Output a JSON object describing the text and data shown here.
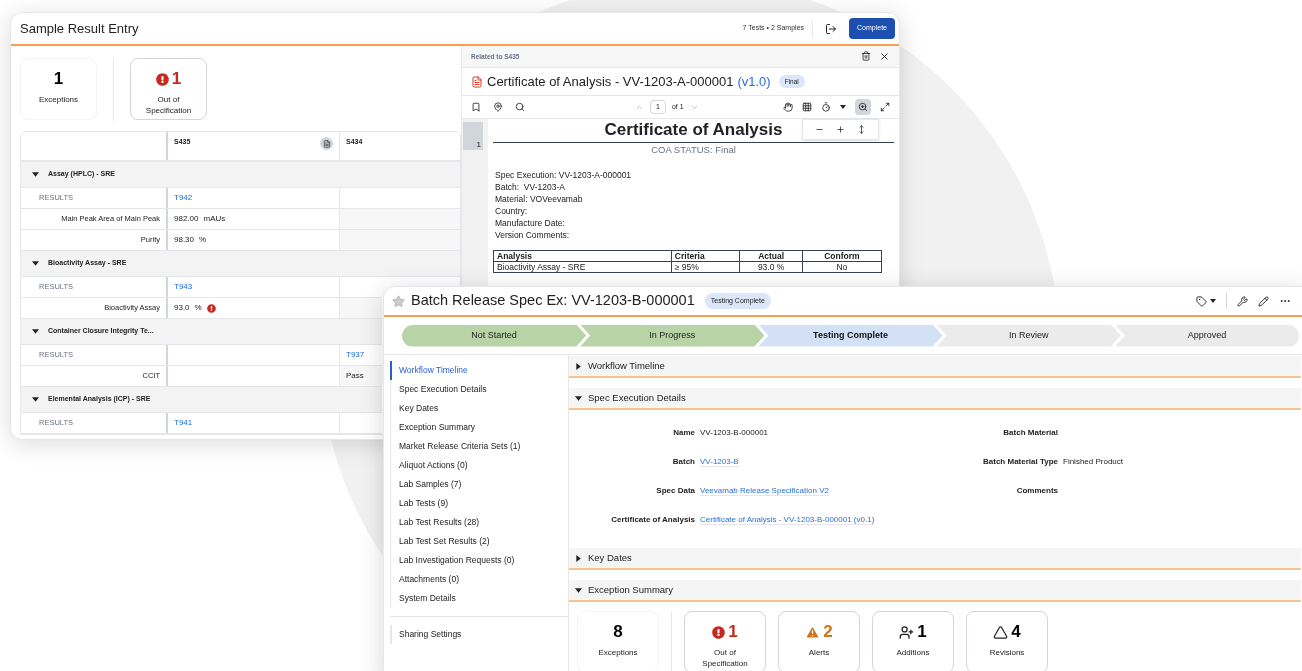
{
  "result_entry": {
    "title": "Sample Result Entry",
    "summary": "7 Tests • 2 Samples",
    "complete_button": "Complete",
    "stats": [
      {
        "kind": "plain",
        "value": "1",
        "label": "Exceptions"
      },
      {
        "kind": "oos",
        "value": "1",
        "label": "Out of Specification"
      }
    ],
    "columns": [
      "S435",
      "S434"
    ],
    "groups": [
      {
        "name": "Assay (HPLC) - SRE",
        "expanded": true,
        "rows": [
          {
            "kind": "results",
            "label": "RESULTS",
            "cell_1": {
              "text": "T942"
            }
          },
          {
            "kind": "value",
            "label": "Main Peak Area of Main Peak",
            "cell_1": {
              "text": "982.00",
              "unit": "mAUs",
              "oos": false
            }
          },
          {
            "kind": "value",
            "label": "Purity",
            "cell_1": {
              "text": "98.30",
              "unit": "%",
              "oos": false
            }
          }
        ]
      },
      {
        "name": "Bioactivity Assay - SRE",
        "expanded": true,
        "rows": [
          {
            "kind": "results",
            "label": "RESULTS",
            "cell_1": {
              "text": "T943"
            }
          },
          {
            "kind": "value",
            "label": "Bioactivity Assay",
            "cell_1": {
              "text": "93.0",
              "unit": "%",
              "oos": true
            }
          }
        ]
      },
      {
        "name": "Container Closure Integrity Te...",
        "expanded": true,
        "rows": [
          {
            "kind": "results",
            "label": "RESULTS",
            "cell_2": {
              "text": "T937"
            }
          },
          {
            "kind": "value",
            "label": "CCIT",
            "cell_2": {
              "text": "Pass"
            }
          }
        ]
      },
      {
        "name": "Elemental Analysis (ICP) - SRE",
        "expanded": true,
        "rows": [
          {
            "kind": "results",
            "label": "RESULTS",
            "cell_1": {
              "text": "T941"
            }
          }
        ]
      }
    ],
    "viewer": {
      "related": "Related to S435",
      "doc_title": "Certificate of Analysis - VV-1203-A-000001",
      "version": "(v1.0)",
      "badge": "Final",
      "page": "1",
      "page_total": "of 1",
      "thumbnail_page": "1",
      "document": {
        "title": "Certificate of Analysis",
        "status": "COA STATUS: Final",
        "lines": [
          "Spec Execution: VV-1203-A-000001",
          "Batch:  VV-1203-A",
          "Material: VOVeevamab",
          "Country:",
          "Manufacture Date:",
          "Version Comments:"
        ],
        "table_columns": [
          "Analysis",
          "Criteria",
          "Actual",
          "Conform"
        ],
        "table_rows": [
          [
            "Bioactivity Assay - SRE",
            "≥ 95%",
            "93.0 %",
            "No"
          ]
        ]
      }
    }
  },
  "batch_release": {
    "title": "Batch Release Spec Ex: VV-1203-B-000001",
    "favorite": false,
    "badge": "Testing Complete",
    "stages": [
      {
        "label": "Not Started",
        "kind": "done"
      },
      {
        "label": "In Progress",
        "kind": "done"
      },
      {
        "label": "Testing Complete",
        "kind": "current"
      },
      {
        "label": "In Review",
        "kind": "todo"
      },
      {
        "label": "Approved",
        "kind": "todo"
      }
    ],
    "sidebar": [
      {
        "label": "Workflow Timeline",
        "selected": true
      },
      {
        "label": "Spec Execution Details",
        "selected": false
      },
      {
        "label": "Key Dates",
        "selected": false
      },
      {
        "label": "Exception Summary",
        "selected": false
      },
      {
        "label": "Market Release Criteria Sets (1)",
        "selected": false
      },
      {
        "label": "Aliquot Actions (0)",
        "selected": false
      },
      {
        "label": "Lab Samples (7)",
        "selected": false
      },
      {
        "label": "Lab Tests (9)",
        "selected": false
      },
      {
        "label": "Lab Test Results (28)",
        "selected": false
      },
      {
        "label": "Lab Test Set Results (2)",
        "selected": false
      },
      {
        "label": "Lab Investigation Requests (0)",
        "selected": false
      },
      {
        "label": "Attachments (0)",
        "selected": false
      },
      {
        "label": "System Details",
        "selected": false
      }
    ],
    "sidebar_footer": {
      "label": "Sharing Settings",
      "selected": false
    },
    "sections": [
      {
        "kind": "plain",
        "title": "Workflow Timeline",
        "expanded": false
      },
      {
        "kind": "fields",
        "title": "Spec Execution Details",
        "expanded": true,
        "rows": [
          {
            "left": {
              "label": "Name",
              "value": "VV-1203-B-000001",
              "link": false
            },
            "right": {
              "label": "Batch Material"
            }
          },
          {
            "left": {
              "label": "Batch",
              "value": "VV-1203-B",
              "link": true
            },
            "right": {
              "label": "Batch Material Type",
              "value": "Finished Product",
              "link": false
            }
          },
          {
            "left": {
              "label": "Spec Data",
              "value": "Veevamab Release Specification V2",
              "link": true
            },
            "right": {
              "label": "Comments"
            }
          },
          {
            "left": {
              "label": "Certificate of Analysis",
              "value": "Certificate of Analysis - VV-1203-B-000001 (v0.1)",
              "link": true
            }
          }
        ]
      },
      {
        "kind": "plain",
        "title": "Key Dates",
        "expanded": false
      },
      {
        "kind": "stats",
        "title": "Exception Summary",
        "expanded": true,
        "stats": [
          {
            "kind": "total",
            "value": "8",
            "label": "Exceptions"
          },
          {
            "kind": "oos",
            "value": "1",
            "label": "Out of Specification"
          },
          {
            "kind": "alert",
            "value": "2",
            "label": "Alerts"
          },
          {
            "kind": "addition",
            "value": "1",
            "label": "Additions"
          },
          {
            "kind": "revision",
            "value": "4",
            "label": "Revisions"
          }
        ]
      }
    ]
  }
}
